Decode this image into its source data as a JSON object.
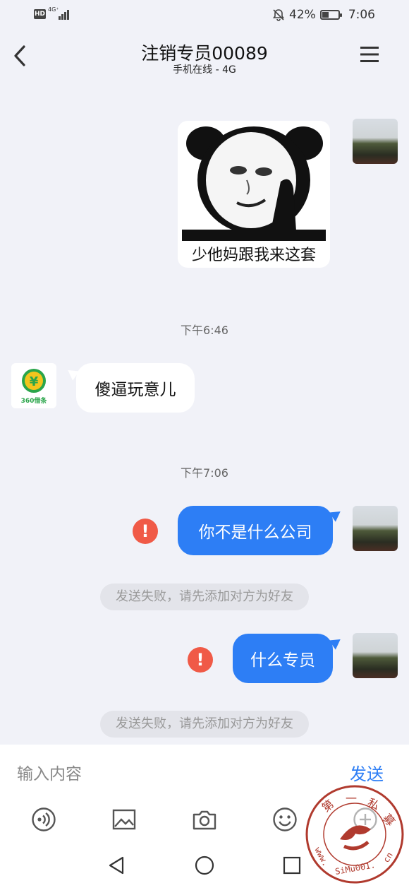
{
  "status_bar": {
    "hd": "HD",
    "network": "4G⁺",
    "battery": "42%",
    "battery_level": 0.42,
    "time": "7:06"
  },
  "header": {
    "title": "注销专员00089",
    "subtitle": "手机在线 - 4G",
    "back_icon": "chevron-left-icon",
    "menu_icon": "hamburger-menu-icon"
  },
  "messages": {
    "sticker_caption": "少他妈跟我来这套",
    "time1": "下午6:46",
    "incoming_text": "傻逼玩意儿",
    "contact_logo_text": "360借条",
    "time2": "下午7:06",
    "out1_text": "你不是什么公司",
    "notice1": "发送失败，请先添加对方为好友",
    "out2_text": "什么专员",
    "notice2": "发送失败，请先添加对方为好友",
    "error_mark": "!"
  },
  "input": {
    "placeholder": "输入内容",
    "send_label": "发送"
  },
  "toolbar_icons": [
    "voice-icon",
    "image-icon",
    "camera-icon",
    "emoji-icon",
    "plus-icon"
  ],
  "nav_icons": [
    "nav-back-icon",
    "nav-home-icon",
    "nav-recents-icon"
  ],
  "watermark": {
    "text": "第一私募 www.SiMu001.cn"
  },
  "colors": {
    "accent": "#2d7ef5",
    "error": "#f05a47",
    "background": "#f1f2f8"
  }
}
